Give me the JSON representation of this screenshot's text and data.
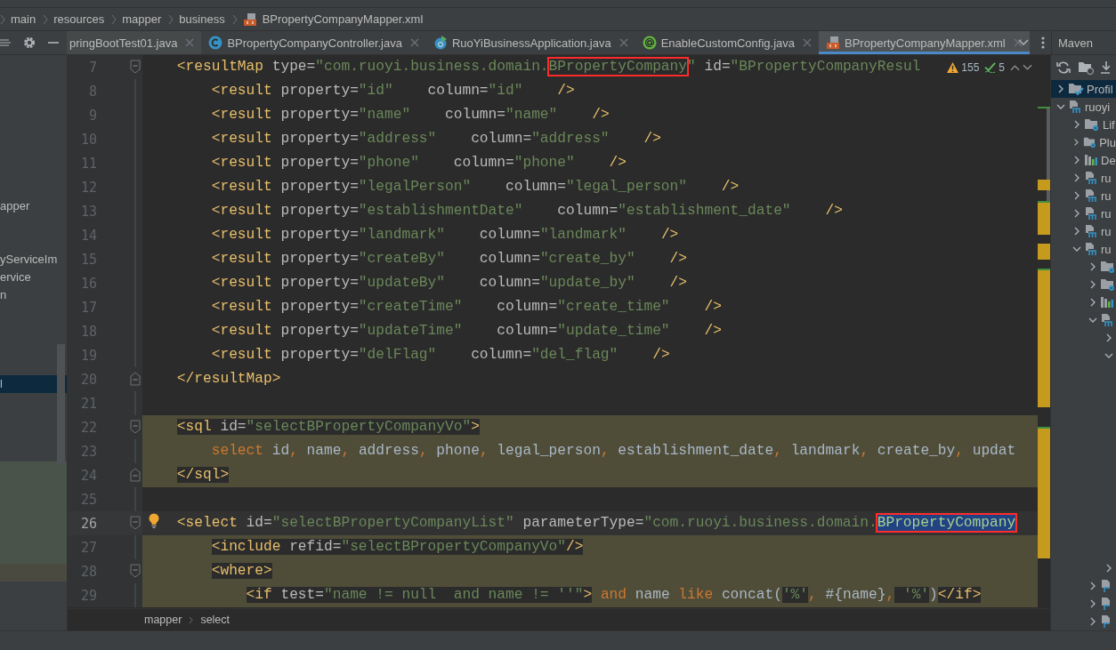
{
  "breadcrumb": [
    {
      "label": "main"
    },
    {
      "label": "resources"
    },
    {
      "label": "mapper"
    },
    {
      "label": "business"
    },
    {
      "label": "BPropertyCompanyMapper.xml",
      "kind": "xml"
    }
  ],
  "tabs": [
    {
      "label": "pringBootTest01.java",
      "selected": false
    },
    {
      "label": "BPropertyCompanyController.java",
      "kind": "class",
      "selected": false
    },
    {
      "label": "RuoYiBusinessApplication.java",
      "kind": "run",
      "selected": false
    },
    {
      "label": "EnableCustomConfig.java",
      "kind": "annotation",
      "selected": false
    },
    {
      "label": "BPropertyCompanyMapper.xml",
      "kind": "xml",
      "selected": true
    }
  ],
  "project_panel": {
    "groups": [
      [
        {
          "label": "apper",
          "selected": false
        }
      ],
      [
        {
          "label": "yServiceIm",
          "selected": false
        },
        {
          "label": "ervice",
          "selected": false
        },
        {
          "label": "n",
          "selected": false
        }
      ],
      [
        {
          "label": "l",
          "selected": true
        }
      ]
    ]
  },
  "editor": {
    "warnings": "155",
    "weak_warnings": "5",
    "lines": [
      {
        "num": "7",
        "kind": "fold_start",
        "segs": [
          {
            "kind": "tag",
            "text": "<resultMap"
          },
          {
            "kind": "attr",
            "text": " type="
          },
          {
            "kind": "val",
            "text": "\"com.ruoyi.business.domain."
          },
          {
            "kind": "val",
            "text": "BPropertyCompany",
            "boxed": true
          },
          {
            "kind": "val",
            "text": "\""
          },
          {
            "kind": "attr",
            "text": " id="
          },
          {
            "kind": "val",
            "text": "\"BPropertyCompanyResul"
          }
        ],
        "children": [
          {
            "num": "8",
            "kind": "plain",
            "segs": [
              {
                "kind": "tag",
                "text": "<result"
              },
              {
                "kind": "attr",
                "text": " property="
              },
              {
                "kind": "val",
                "text": "\"id\""
              },
              {
                "kind": "attr",
                "text": "    column="
              },
              {
                "kind": "val",
                "text": "\"id\""
              },
              {
                "kind": "tag",
                "text": "    />"
              }
            ]
          },
          {
            "num": "9",
            "kind": "plain",
            "segs": [
              {
                "kind": "tag",
                "text": "<result"
              },
              {
                "kind": "attr",
                "text": " property="
              },
              {
                "kind": "val",
                "text": "\"name\""
              },
              {
                "kind": "attr",
                "text": "    column="
              },
              {
                "kind": "val",
                "text": "\"name\""
              },
              {
                "kind": "tag",
                "text": "    />"
              }
            ]
          },
          {
            "num": "10",
            "kind": "plain",
            "segs": [
              {
                "kind": "tag",
                "text": "<result"
              },
              {
                "kind": "attr",
                "text": " property="
              },
              {
                "kind": "val",
                "text": "\"address\""
              },
              {
                "kind": "attr",
                "text": "    column="
              },
              {
                "kind": "val",
                "text": "\"address\""
              },
              {
                "kind": "tag",
                "text": "    />"
              }
            ]
          },
          {
            "num": "11",
            "kind": "plain",
            "segs": [
              {
                "kind": "tag",
                "text": "<result"
              },
              {
                "kind": "attr",
                "text": " property="
              },
              {
                "kind": "val",
                "text": "\"phone\""
              },
              {
                "kind": "attr",
                "text": "    column="
              },
              {
                "kind": "val",
                "text": "\"phone\""
              },
              {
                "kind": "tag",
                "text": "    />"
              }
            ]
          },
          {
            "num": "12",
            "kind": "plain",
            "segs": [
              {
                "kind": "tag",
                "text": "<result"
              },
              {
                "kind": "attr",
                "text": " property="
              },
              {
                "kind": "val",
                "text": "\"legalPerson\""
              },
              {
                "kind": "attr",
                "text": "    column="
              },
              {
                "kind": "val",
                "text": "\"legal_person\""
              },
              {
                "kind": "tag",
                "text": "    />"
              }
            ]
          },
          {
            "num": "13",
            "kind": "plain",
            "segs": [
              {
                "kind": "tag",
                "text": "<result"
              },
              {
                "kind": "attr",
                "text": " property="
              },
              {
                "kind": "val",
                "text": "\"establishmentDate\""
              },
              {
                "kind": "attr",
                "text": "    column="
              },
              {
                "kind": "val",
                "text": "\"establishment_date\""
              },
              {
                "kind": "tag",
                "text": "    />"
              }
            ]
          },
          {
            "num": "14",
            "kind": "plain",
            "segs": [
              {
                "kind": "tag",
                "text": "<result"
              },
              {
                "kind": "attr",
                "text": " property="
              },
              {
                "kind": "val",
                "text": "\"landmark\""
              },
              {
                "kind": "attr",
                "text": "    column="
              },
              {
                "kind": "val",
                "text": "\"landmark\""
              },
              {
                "kind": "tag",
                "text": "    />"
              }
            ]
          },
          {
            "num": "15",
            "kind": "plain",
            "segs": [
              {
                "kind": "tag",
                "text": "<result"
              },
              {
                "kind": "attr",
                "text": " property="
              },
              {
                "kind": "val",
                "text": "\"createBy\""
              },
              {
                "kind": "attr",
                "text": "    column="
              },
              {
                "kind": "val",
                "text": "\"create_by\""
              },
              {
                "kind": "tag",
                "text": "    />"
              }
            ]
          },
          {
            "num": "16",
            "kind": "plain",
            "segs": [
              {
                "kind": "tag",
                "text": "<result"
              },
              {
                "kind": "attr",
                "text": " property="
              },
              {
                "kind": "val",
                "text": "\"updateBy\""
              },
              {
                "kind": "attr",
                "text": "    column="
              },
              {
                "kind": "val",
                "text": "\"update_by\""
              },
              {
                "kind": "tag",
                "text": "    />"
              }
            ]
          },
          {
            "num": "17",
            "kind": "plain",
            "segs": [
              {
                "kind": "tag",
                "text": "<result"
              },
              {
                "kind": "attr",
                "text": " property="
              },
              {
                "kind": "val",
                "text": "\"createTime\""
              },
              {
                "kind": "attr",
                "text": "    column="
              },
              {
                "kind": "val",
                "text": "\"create_time\""
              },
              {
                "kind": "tag",
                "text": "    />"
              }
            ]
          },
          {
            "num": "18",
            "kind": "plain",
            "segs": [
              {
                "kind": "tag",
                "text": "<result"
              },
              {
                "kind": "attr",
                "text": " property="
              },
              {
                "kind": "val",
                "text": "\"updateTime\""
              },
              {
                "kind": "attr",
                "text": "    column="
              },
              {
                "kind": "val",
                "text": "\"update_time\""
              },
              {
                "kind": "tag",
                "text": "    />"
              }
            ]
          },
          {
            "num": "19",
            "kind": "plain",
            "segs": [
              {
                "kind": "tag",
                "text": "<result"
              },
              {
                "kind": "attr",
                "text": " property="
              },
              {
                "kind": "val",
                "text": "\"delFlag\""
              },
              {
                "kind": "attr",
                "text": "    column="
              },
              {
                "kind": "val",
                "text": "\"del_flag\""
              },
              {
                "kind": "tag",
                "text": "    />"
              }
            ]
          }
        ]
      },
      {
        "num": "20",
        "kind": "fold_end",
        "segs": [
          {
            "kind": "tag",
            "text": "</resultMap>"
          }
        ]
      },
      {
        "num": "21",
        "kind": "plain"
      },
      {
        "num": "22",
        "kind": "fold_start",
        "injected": true,
        "segs": [
          {
            "kind": "tag",
            "text": "<sql"
          },
          {
            "kind": "attr",
            "text": " id="
          },
          {
            "kind": "val",
            "text": "\"selectBPropertyCompanyVo\""
          },
          {
            "kind": "tag",
            "text": ">"
          }
        ],
        "children": [
          {
            "num": "23",
            "kind": "plain",
            "injected": true,
            "segs": [
              {
                "kind": "kw",
                "text": "select"
              },
              {
                "kind": "sql",
                "text": " id"
              },
              {
                "kind": "kw",
                "text": ","
              },
              {
                "kind": "sql",
                "text": " name"
              },
              {
                "kind": "kw",
                "text": ","
              },
              {
                "kind": "sql",
                "text": " address"
              },
              {
                "kind": "kw",
                "text": ","
              },
              {
                "kind": "sql",
                "text": " phone"
              },
              {
                "kind": "kw",
                "text": ","
              },
              {
                "kind": "sql",
                "text": " legal_person"
              },
              {
                "kind": "kw",
                "text": ","
              },
              {
                "kind": "sql",
                "text": " establishment_date"
              },
              {
                "kind": "kw",
                "text": ","
              },
              {
                "kind": "sql",
                "text": " landmark"
              },
              {
                "kind": "kw",
                "text": ","
              },
              {
                "kind": "sql",
                "text": " create_by"
              },
              {
                "kind": "kw",
                "text": ","
              },
              {
                "kind": "sql",
                "text": " updat"
              }
            ]
          }
        ]
      },
      {
        "num": "24",
        "kind": "fold_end",
        "injected": true,
        "segs": [
          {
            "kind": "tag",
            "text": "</sql>"
          }
        ]
      },
      {
        "num": "25",
        "kind": "plain"
      },
      {
        "num": "26",
        "kind": "fold_start",
        "current": true,
        "bulb": true,
        "segs": [
          {
            "kind": "tag",
            "text": "<select"
          },
          {
            "kind": "attr",
            "text": " id="
          },
          {
            "kind": "val",
            "text": "\"selectBPropertyCompanyList\""
          },
          {
            "kind": "attr",
            "text": " parameterType="
          },
          {
            "kind": "val",
            "text": "\"com.ruoyi.business.domain."
          },
          {
            "kind": "val",
            "text": "BPropertyCompany",
            "boxed": true,
            "highlighted": true
          }
        ],
        "children": [
          {
            "num": "27",
            "kind": "plain",
            "injected": true,
            "segs": [
              {
                "kind": "tag",
                "text": "<include"
              },
              {
                "kind": "attr",
                "text": " refid="
              },
              {
                "kind": "val",
                "text": "\"selectBPropertyCompanyVo\""
              },
              {
                "kind": "tag",
                "text": "/>"
              }
            ]
          },
          {
            "num": "28",
            "kind": "fold_start",
            "injected": true,
            "segs": [
              {
                "kind": "tag",
                "text": "<where>"
              }
            ],
            "children": [
              {
                "num": "29",
                "kind": "plain",
                "injected": true,
                "segs": [
                  {
                    "kind": "tag",
                    "text": "<if"
                  },
                  {
                    "kind": "attr",
                    "text": " test="
                  },
                  {
                    "kind": "val",
                    "text": "\"name != null  and name != ''\""
                  },
                  {
                    "kind": "tag",
                    "text": ">"
                  },
                  {
                    "kind": "kw",
                    "text": " and"
                  },
                  {
                    "kind": "sql",
                    "text": " name"
                  },
                  {
                    "kind": "kw",
                    "text": " like"
                  },
                  {
                    "kind": "sql",
                    "text": " concat("
                  },
                  {
                    "kind": "val",
                    "text": "'%'"
                  },
                  {
                    "kind": "kw",
                    "text": ","
                  },
                  {
                    "kind": "sql",
                    "text": " #{name}"
                  },
                  {
                    "kind": "kw",
                    "text": ","
                  },
                  {
                    "kind": "val",
                    "text": " '%'"
                  },
                  {
                    "kind": "sql",
                    "text": ")"
                  },
                  {
                    "kind": "tag",
                    "text": "</if>"
                  }
                ]
              }
            ]
          }
        ]
      }
    ],
    "bottom_crumbs": [
      "mapper",
      "select"
    ]
  },
  "maven": {
    "title": "Maven",
    "tree": [
      {
        "label": "Profil",
        "kind": "profiles",
        "expanded": false,
        "selected": true
      },
      {
        "label": "ruoyi",
        "kind": "module",
        "expanded": true,
        "selected": false,
        "children": [
          {
            "label": "Lif",
            "kind": "lifecycle",
            "expanded": false,
            "selected": false
          },
          {
            "label": "Plu",
            "kind": "plugins",
            "expanded": false,
            "selected": false
          },
          {
            "label": "De",
            "kind": "dependencies",
            "expanded": false,
            "selected": false
          },
          {
            "label": "ru",
            "kind": "module",
            "expanded": false,
            "selected": false
          },
          {
            "label": "ru",
            "kind": "module",
            "expanded": false,
            "selected": false
          },
          {
            "label": "ru",
            "kind": "module",
            "expanded": false,
            "selected": false
          },
          {
            "label": "ru",
            "kind": "module",
            "expanded": false,
            "selected": false
          },
          {
            "label": "ru",
            "kind": "module",
            "expanded": true,
            "selected": false,
            "children": [
              {
                "kind": "lifecycle",
                "expanded": false,
                "selected": false
              },
              {
                "kind": "plugins",
                "expanded": false,
                "selected": false
              },
              {
                "kind": "dependencies",
                "expanded": false,
                "selected": false
              },
              {
                "kind": "module",
                "expanded": true,
                "selected": false,
                "children": [
                  {
                    "expanded": false,
                    "selected": false
                  },
                  {
                    "expanded": true,
                    "selected": false
                  }
                ]
              }
            ]
          }
        ]
      }
    ],
    "tail_deep": [
      {
        "expanded": false,
        "selected": false
      }
    ],
    "tail_modules": [
      {
        "kind": "module",
        "expanded": false,
        "selected": false
      },
      {
        "kind": "module",
        "expanded": false,
        "selected": false
      },
      {
        "kind": "module",
        "expanded": false,
        "selected": false
      }
    ]
  }
}
